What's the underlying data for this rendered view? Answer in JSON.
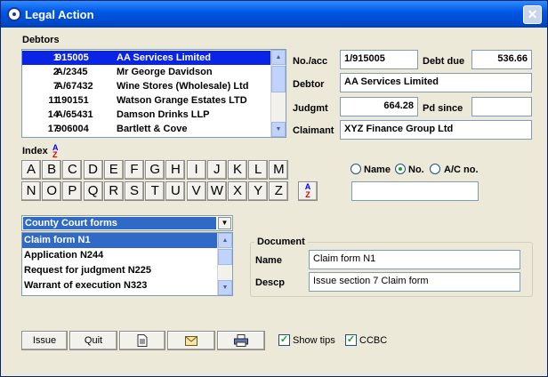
{
  "window": {
    "title": "Legal Action"
  },
  "debtors": {
    "label": "Debtors",
    "rows": [
      {
        "num": "1",
        "acc": "915005",
        "name": "AA Services Limited"
      },
      {
        "num": "2",
        "acc": "A/2345",
        "name": "Mr George Davidson"
      },
      {
        "num": "7",
        "acc": "A/67432",
        "name": "Wine Stores (Wholesale) Ltd"
      },
      {
        "num": "11",
        "acc": "190151",
        "name": "Watson Grange Estates LTD"
      },
      {
        "num": "14",
        "acc": "A/65431",
        "name": "Damson Drinks LLP"
      },
      {
        "num": "17",
        "acc": "906004",
        "name": "Bartlett & Cove"
      }
    ]
  },
  "details": {
    "no_acc_label": "No./acc",
    "no_acc_value": "1/915005",
    "debt_due_label": "Debt due",
    "debt_due_value": "536.66",
    "debtor_label": "Debtor",
    "debtor_value": "AA Services Limited",
    "judgmt_label": "Judgmt",
    "judgmt_value": "664.28",
    "pd_since_label": "Pd since",
    "pd_since_value": "",
    "claimant_label": "Claimant",
    "claimant_value": "XYZ Finance Group Ltd"
  },
  "index": {
    "label": "Index",
    "row1": [
      "A",
      "B",
      "C",
      "D",
      "E",
      "F",
      "G",
      "H",
      "I",
      "J",
      "K",
      "L",
      "M"
    ],
    "row2": [
      "N",
      "O",
      "P",
      "Q",
      "R",
      "S",
      "T",
      "U",
      "V",
      "W",
      "X",
      "Y",
      "Z"
    ]
  },
  "search": {
    "options": [
      "Name",
      "No.",
      "A/C no."
    ],
    "selected": "No.",
    "value": ""
  },
  "forms": {
    "combo_value": "County Court forms",
    "items": [
      "Claim form N1",
      "Application N244",
      "Request for judgment N225",
      "Warrant of execution N323"
    ]
  },
  "document": {
    "legend": "Document",
    "name_label": "Name",
    "name_value": "Claim form N1",
    "descp_label": "Descp",
    "descp_value": "Issue section 7 Claim form"
  },
  "toolbar": {
    "issue_label": "Issue",
    "quit_label": "Quit",
    "document_icon": "document-icon",
    "email_icon": "envelope-icon",
    "print_icon": "printer-icon"
  },
  "options": {
    "show_tips_label": "Show tips",
    "show_tips_checked": true,
    "ccbc_label": "CCBC",
    "ccbc_checked": true
  }
}
